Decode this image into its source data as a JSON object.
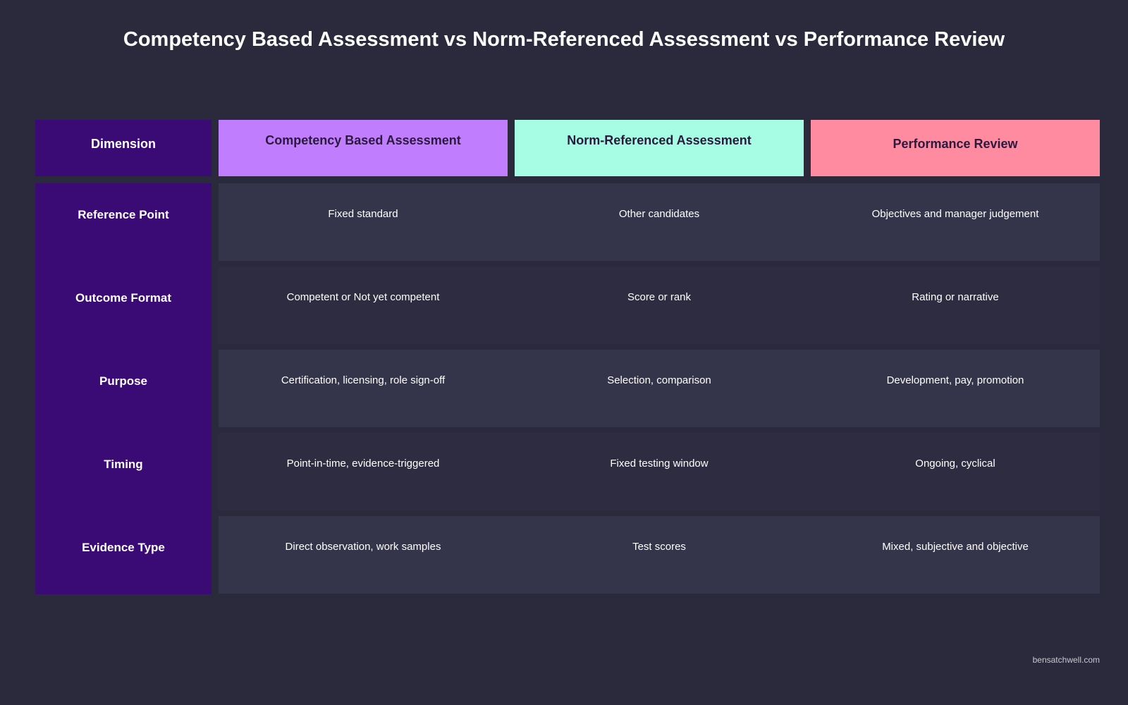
{
  "title": "Competency Based Assessment vs Norm-Referenced Assessment vs Performance Review",
  "header": {
    "dimension": "Dimension",
    "columns": [
      {
        "label": "Competency Based Assessment",
        "color": "#c07dfd"
      },
      {
        "label": "Norm-Referenced Assessment",
        "color": "#a6fde3"
      },
      {
        "label": "Performance Review",
        "color": "#fe8ba0"
      }
    ]
  },
  "colors": {
    "background": "#2b2a3d",
    "dimension_column": "#3a0b75",
    "row_band_light": "#34344a",
    "row_band_dark": "#2d2c40"
  },
  "rows": [
    {
      "label": "Reference Point",
      "cells": [
        "Fixed standard",
        "Other candidates",
        "Objectives and manager judgement"
      ]
    },
    {
      "label": "Outcome Format",
      "cells": [
        "Competent or Not yet competent",
        "Score or rank",
        "Rating or narrative"
      ]
    },
    {
      "label": "Purpose",
      "cells": [
        "Certification, licensing, role sign-off",
        "Selection, comparison",
        "Development, pay, promotion"
      ]
    },
    {
      "label": "Timing",
      "cells": [
        "Point-in-time, evidence-triggered",
        "Fixed testing window",
        "Ongoing, cyclical"
      ]
    },
    {
      "label": "Evidence Type",
      "cells": [
        "Direct observation, work samples",
        "Test scores",
        "Mixed, subjective and objective"
      ]
    }
  ],
  "footer": "bensatchwell.com"
}
